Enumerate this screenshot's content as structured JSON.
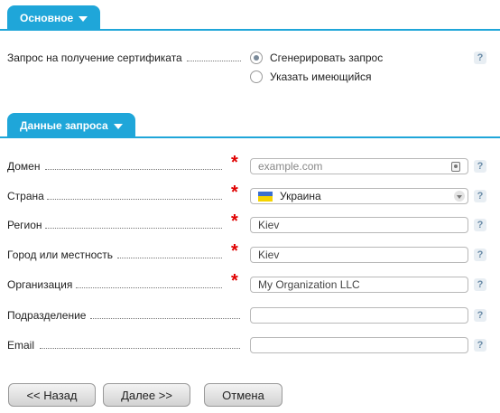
{
  "sections": {
    "basic": {
      "title": "Основное"
    },
    "request": {
      "title": "Данные запроса"
    }
  },
  "certificate": {
    "label": "Запрос на получение сертификата",
    "options": [
      {
        "label": "Сгенерировать запрос",
        "checked": true
      },
      {
        "label": "Указать имеющийся",
        "checked": false
      }
    ],
    "help": "?"
  },
  "fields": {
    "domain": {
      "label": "Домен",
      "required": "*",
      "value": "",
      "placeholder": "example.com",
      "help": "?"
    },
    "country": {
      "label": "Страна",
      "required": "*",
      "value": "Украина",
      "help": "?"
    },
    "region": {
      "label": "Регион",
      "required": "*",
      "value": "Kiev",
      "placeholder": "",
      "help": "?"
    },
    "city": {
      "label": "Город или местность",
      "required": "*",
      "value": "Kiev",
      "placeholder": "",
      "help": "?"
    },
    "organization": {
      "label": "Организация",
      "required": "*",
      "value": "My Organization LLC",
      "placeholder": "",
      "help": "?"
    },
    "department": {
      "label": "Подразделение",
      "value": "",
      "placeholder": "",
      "help": "?"
    },
    "email": {
      "label": "Email",
      "value": "",
      "placeholder": "",
      "help": "?"
    }
  },
  "buttons": {
    "back": "<< Назад",
    "next": "Далее >>",
    "cancel": "Отмена"
  },
  "colors": {
    "accent": "#1fa6d9",
    "required": "#e00000"
  },
  "icons": {
    "section_toggle": "caret-down-icon",
    "help": "help-icon",
    "contact_card": "contact-card-icon",
    "dropdown": "chevron-down-icon"
  }
}
